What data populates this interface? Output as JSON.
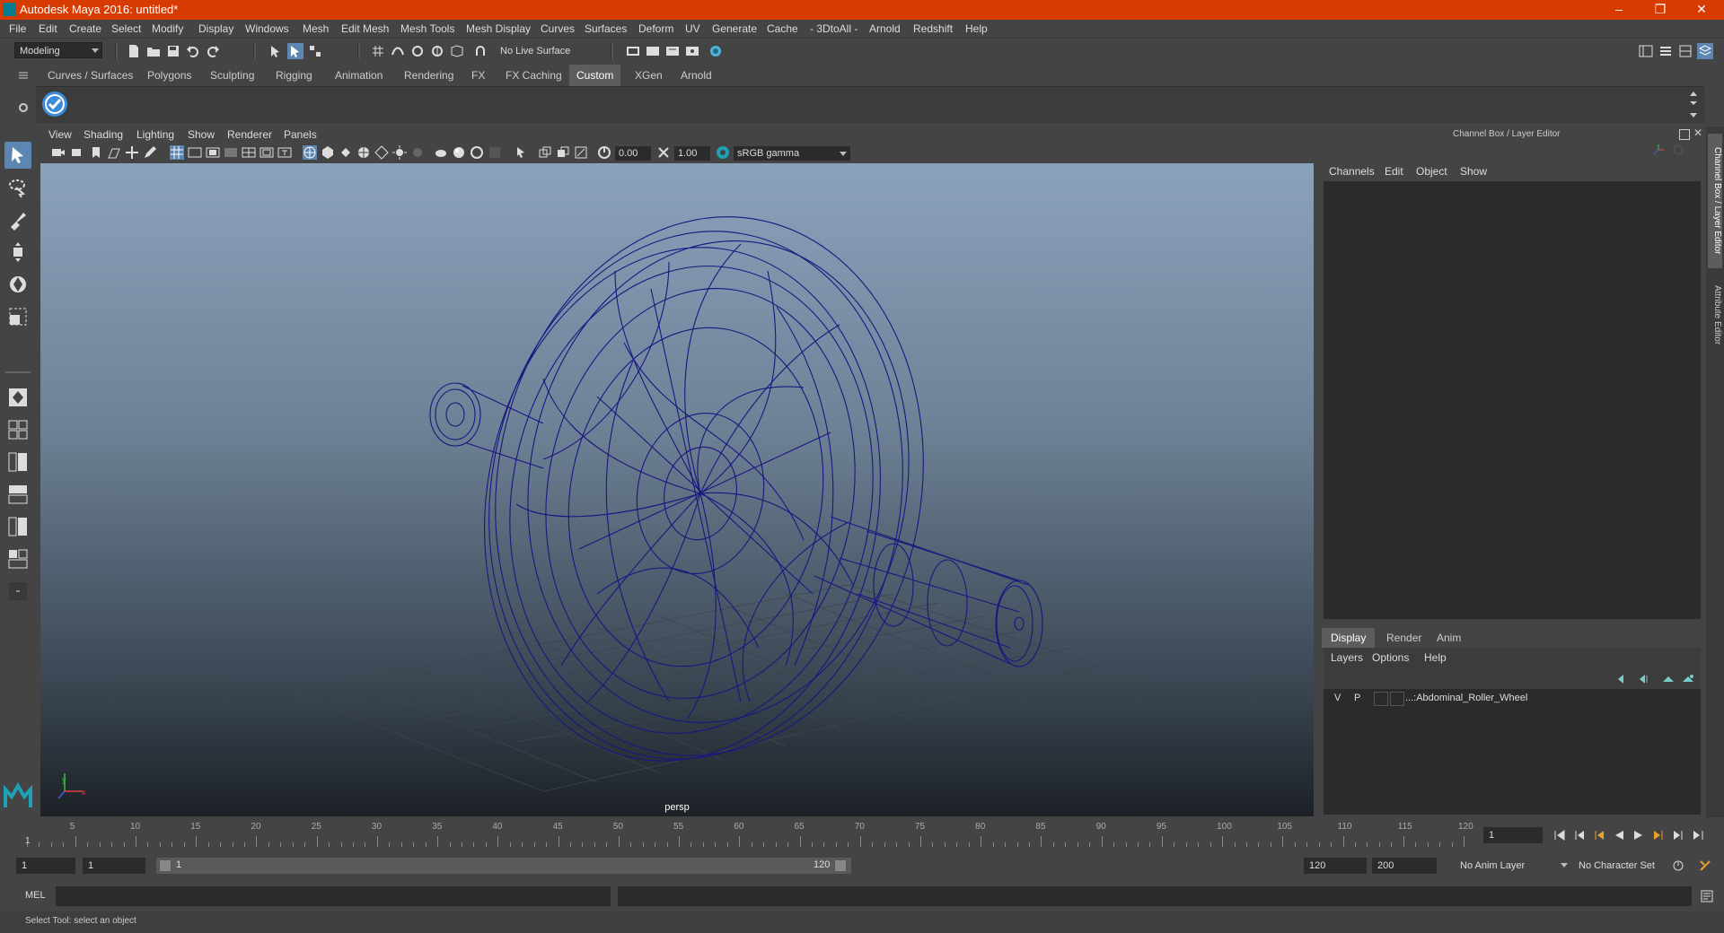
{
  "window": {
    "title": "Autodesk Maya 2016: untitled*",
    "minimize": "–",
    "restore": "❐",
    "close": "✕"
  },
  "menus": [
    "File",
    "Edit",
    "Create",
    "Select",
    "Modify",
    "Display",
    "Windows",
    "Mesh",
    "Edit Mesh",
    "Mesh Tools",
    "Mesh Display",
    "Curves",
    "Surfaces",
    "Deform",
    "UV",
    "Generate",
    "Cache",
    "- 3DtoAll -",
    "Arnold",
    "Redshift",
    "Help"
  ],
  "statusline": {
    "menuset": "Modeling",
    "live_surface": "No Live Surface"
  },
  "shelf": {
    "tabs": [
      "Curves / Surfaces",
      "Polygons",
      "Sculpting",
      "Rigging",
      "Animation",
      "Rendering",
      "FX",
      "FX Caching",
      "Custom",
      "XGen",
      "Arnold"
    ],
    "active_tab": "Custom"
  },
  "viewport": {
    "panel_menus": [
      "View",
      "Shading",
      "Lighting",
      "Show",
      "Renderer",
      "Panels"
    ],
    "exposure": "0.00",
    "gamma": "1.00",
    "color_space": "sRGB gamma",
    "camera_label": "persp",
    "axis_y": "y",
    "axis_x": "x",
    "wire_color": "#1a1680"
  },
  "channel_box": {
    "title": "Channel Box / Layer Editor",
    "menus": [
      "Channels",
      "Edit",
      "Object",
      "Show"
    ]
  },
  "layer_editor": {
    "tabs": [
      "Display",
      "Render",
      "Anim"
    ],
    "active_tab": "Display",
    "menus": [
      "Layers",
      "Options",
      "Help"
    ],
    "layers": [
      {
        "v": "V",
        "p": "P",
        "name": "...:Abdominal_Roller_Wheel"
      }
    ]
  },
  "side_tabs": [
    "Channel Box / Layer Editor",
    "Attribute Editor"
  ],
  "timeline": {
    "ticks": [
      "5",
      "10",
      "15",
      "20",
      "25",
      "30",
      "35",
      "40",
      "45",
      "50",
      "55",
      "60",
      "65",
      "70",
      "75",
      "80",
      "85",
      "90",
      "95",
      "100",
      "105",
      "110",
      "115",
      "120"
    ],
    "current_frame_marker": "1",
    "current_frame": "1"
  },
  "range": {
    "start_time": "1",
    "playback_start": "1",
    "slider_start": "1",
    "slider_end": "120",
    "playback_end": "120",
    "end_time": "200",
    "anim_layer": "No Anim Layer",
    "character_set": "No Character Set"
  },
  "command_line": {
    "label": "MEL"
  },
  "help_line": {
    "text": "Select Tool: select an object"
  }
}
